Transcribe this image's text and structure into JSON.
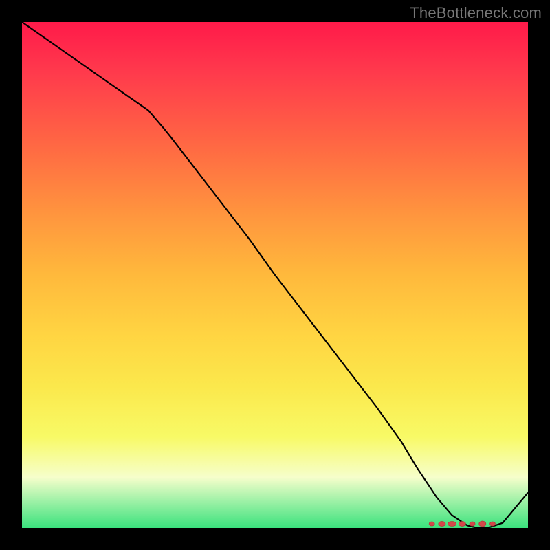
{
  "chart_data": {
    "type": "line",
    "watermark": "TheBottleneck.com",
    "title": "",
    "xlabel": "",
    "ylabel": "",
    "x": [
      0,
      5,
      10,
      15,
      20,
      25,
      28,
      30,
      35,
      40,
      45,
      50,
      55,
      60,
      65,
      70,
      75,
      78,
      80,
      82,
      85,
      88,
      90,
      92,
      95,
      100
    ],
    "values": [
      100,
      96.5,
      93,
      89.5,
      86,
      82.5,
      79,
      76.5,
      70,
      63.5,
      57,
      50,
      43.5,
      37,
      30.5,
      24,
      17,
      12,
      9,
      6,
      2.5,
      0.5,
      0,
      0,
      1,
      7
    ],
    "xlim": [
      0,
      100
    ],
    "ylim": [
      0,
      100
    ],
    "highlight_range": [
      80,
      92
    ],
    "marker_color": "#d2484a",
    "line_color": "#000000"
  }
}
